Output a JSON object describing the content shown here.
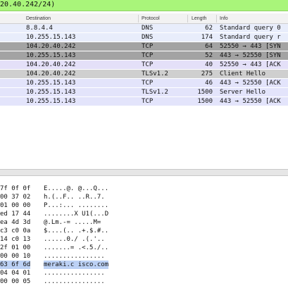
{
  "filter": {
    "text": "20.40.242/24)"
  },
  "columns": {
    "destination": "Destination",
    "protocol": "Protocol",
    "length": "Length",
    "info": "Info"
  },
  "packets": [
    {
      "destination": "8.8.4.4",
      "protocol": "DNS",
      "length": "62",
      "info": "Standard query 0",
      "style": "light"
    },
    {
      "destination": "10.255.15.143",
      "protocol": "DNS",
      "length": "174",
      "info": "Standard query r",
      "style": "light"
    },
    {
      "destination": "104.20.40.242",
      "protocol": "TCP",
      "length": "64",
      "info": "52550 → 443 [SYN",
      "style": "dark"
    },
    {
      "destination": "10.255.15.143",
      "protocol": "TCP",
      "length": "52",
      "info": "443 → 52550 [SYN",
      "style": "dark"
    },
    {
      "destination": "104.20.40.242",
      "protocol": "TCP",
      "length": "40",
      "info": "52550 → 443 [ACK",
      "style": "purple"
    },
    {
      "destination": "104.20.40.242",
      "protocol": "TLSv1.2",
      "length": "275",
      "info": "Client Hello",
      "style": "gray"
    },
    {
      "destination": "10.255.15.143",
      "protocol": "TCP",
      "length": "46",
      "info": "443 → 52550 [ACK",
      "style": "blue"
    },
    {
      "destination": "10.255.15.143",
      "protocol": "TLSv1.2",
      "length": "1500",
      "info": "Server Hello",
      "style": "blue"
    },
    {
      "destination": "10.255.15.143",
      "protocol": "TCP",
      "length": "1500",
      "info": "443 → 52550 [ACK",
      "style": "blue"
    }
  ],
  "bytes": [
    {
      "hex": "7f 0f 0f",
      "ascii": "E.....@. @...Q...",
      "highlight": false
    },
    {
      "hex": "00 37 02",
      "ascii": "h.(..F.. ..R..7.",
      "highlight": false
    },
    {
      "hex": "01 00 00",
      "ascii": "P...:... ........",
      "highlight": false
    },
    {
      "hex": "ed 17 44",
      "ascii": "........X U1(...D",
      "highlight": false
    },
    {
      "hex": "ea 4d 3d",
      "ascii": "@.Lm.-=  .....M=",
      "highlight": false
    },
    {
      "hex": "c3 c0 0a",
      "ascii": "$....(.. .+.$.#..",
      "highlight": false
    },
    {
      "hex": "14 c0 13",
      "ascii": "......0./ .(.'..",
      "highlight": false
    },
    {
      "hex": "2f 01 00",
      "ascii": ".......= .<.5./..",
      "highlight": false
    },
    {
      "hex": "00 00 10",
      "ascii": "................",
      "highlight": false
    },
    {
      "hex": "63 6f 6d",
      "ascii": "meraki.c isco.com",
      "highlight": true
    },
    {
      "hex": "04 04 01",
      "ascii": "................",
      "highlight": false
    },
    {
      "hex": "00 00 05",
      "ascii": "................",
      "highlight": false
    }
  ]
}
